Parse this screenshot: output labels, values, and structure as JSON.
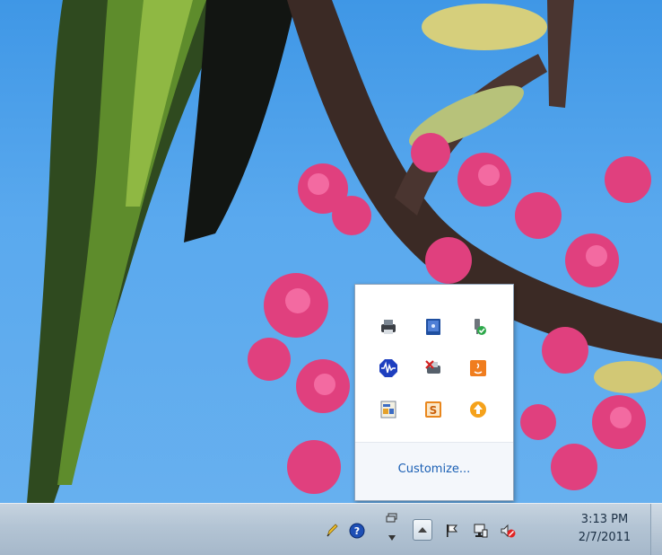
{
  "wallpaper": {
    "description_colors": {
      "sky": "#4aa0ea",
      "blossom": "#e0407e",
      "branch": "#3b2a25"
    }
  },
  "tray_popup": {
    "icons": [
      {
        "name": "printer-icon"
      },
      {
        "name": "device-manager-icon"
      },
      {
        "name": "power-plug-check-icon"
      },
      {
        "name": "audio-wave-icon"
      },
      {
        "name": "network-printer-error-icon"
      },
      {
        "name": "java-icon"
      },
      {
        "name": "document-icon"
      },
      {
        "name": "s-app-icon"
      },
      {
        "name": "update-arrow-icon"
      }
    ],
    "customize_label": "Customize..."
  },
  "taskbar": {
    "tray_icons": [
      {
        "name": "pencil-icon"
      },
      {
        "name": "help-icon"
      },
      {
        "name": "windows-mini-icon"
      },
      {
        "name": "show-hidden-icons-button"
      },
      {
        "name": "action-center-flag-icon"
      },
      {
        "name": "network-icon"
      },
      {
        "name": "volume-muted-icon"
      }
    ],
    "clock": {
      "time": "3:13 PM",
      "date": "2/7/2011"
    }
  }
}
